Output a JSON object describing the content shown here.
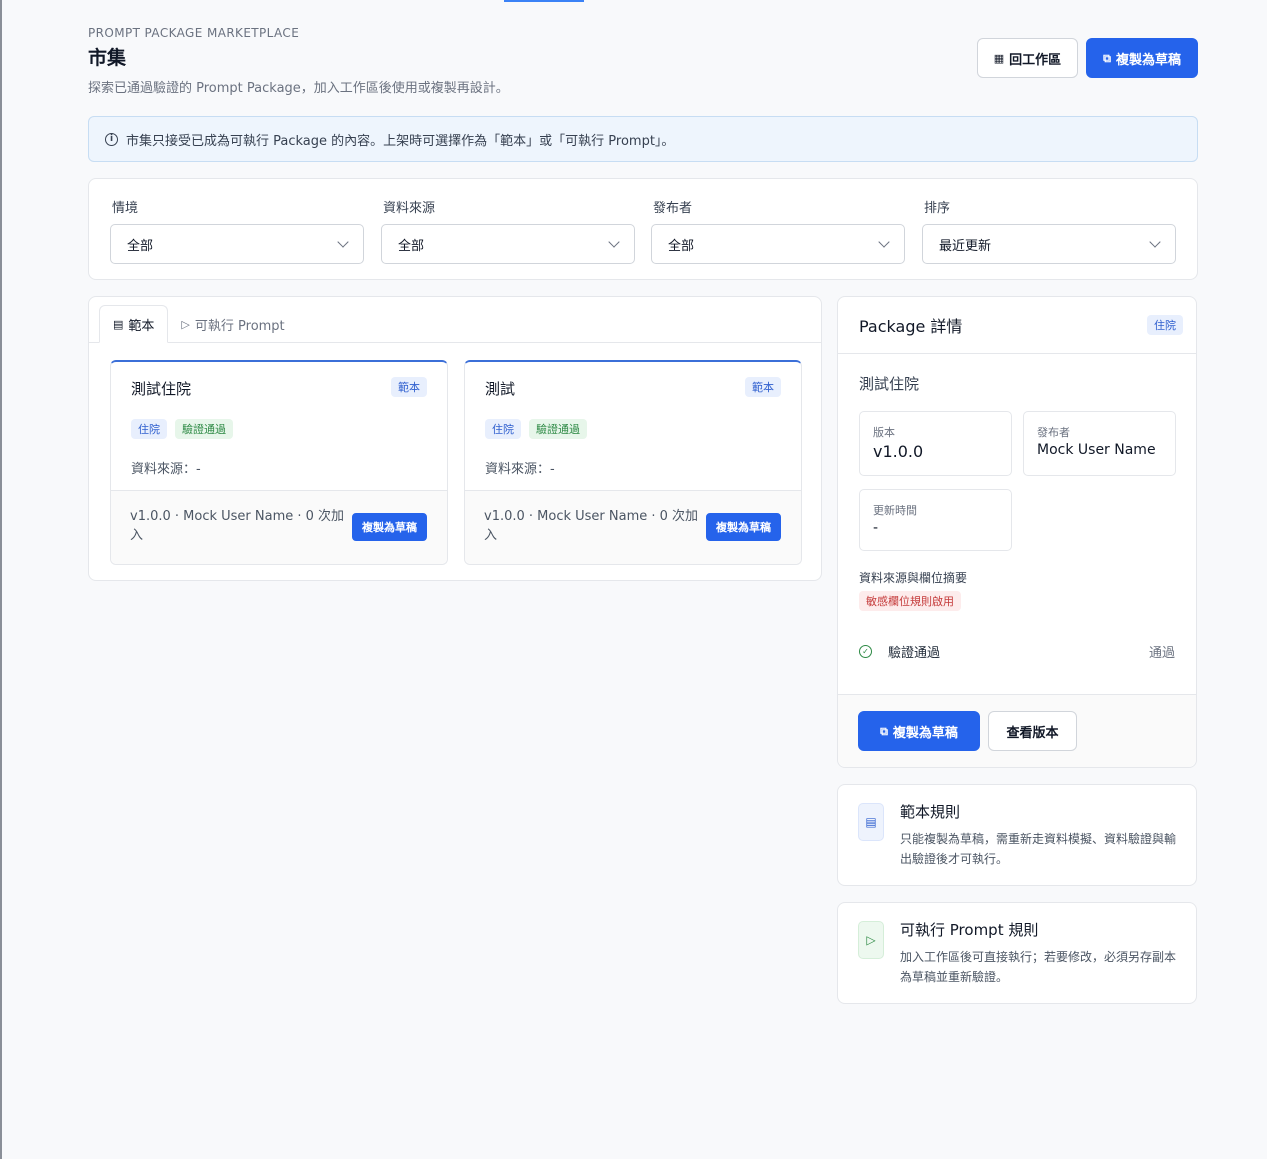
{
  "header": {
    "eyebrow": "PROMPT PACKAGE MARKETPLACE",
    "title": "市集",
    "subtitle": "探索已通過驗證的 Prompt Package，加入工作區後使用或複製再設計。",
    "back_label": "回工作區",
    "copy_label": "複製為草稿"
  },
  "banner": {
    "text": "市集只接受已成為可執行 Package 的內容。上架時可選擇作為「範本」或「可執行 Prompt」。"
  },
  "filters": [
    {
      "label": "情境",
      "value": "全部"
    },
    {
      "label": "資料來源",
      "value": "全部"
    },
    {
      "label": "發布者",
      "value": "全部"
    },
    {
      "label": "排序",
      "value": "最近更新"
    }
  ],
  "tabs": [
    {
      "label": "範本",
      "active": true
    },
    {
      "label": "可執行 Prompt",
      "active": false
    }
  ],
  "cards": [
    {
      "title": "測試住院",
      "type": "範本",
      "tags": [
        "住院",
        "驗證通過"
      ],
      "source": "資料來源：-",
      "meta": "v1.0.0 · Mock User Name · 0 次加入",
      "copy_label": "複製為草稿"
    },
    {
      "title": "測試",
      "type": "範本",
      "tags": [
        "住院",
        "驗證通過"
      ],
      "source": "資料來源：-",
      "meta": "v1.0.0 · Mock User Name · 0 次加入",
      "copy_label": "複製為草稿"
    }
  ],
  "detail": {
    "title": "Package 詳情",
    "badge": "住院",
    "name": "測試住院",
    "version_label": "版本",
    "version": "v1.0.0",
    "publisher_label": "發布者",
    "publisher": "Mock User Name",
    "updated_label": "更新時間",
    "updated": "-",
    "summary_label": "資料來源與欄位摘要",
    "sensitive_badge": "敏感欄位規則啟用",
    "check_label": "驗證通過",
    "check_status": "通過",
    "copy_label": "複製為草稿",
    "versions_label": "查看版本"
  },
  "rules": [
    {
      "title": "範本規則",
      "desc": "只能複製為草稿，需重新走資料模擬、資料驗證與輸出驗證後才可執行。",
      "icon": "template-icon"
    },
    {
      "title": "可執行 Prompt 規則",
      "desc": "加入工作區後可直接執行；若要修改，必須另存副本為草稿並重新驗證。",
      "icon": "play-icon"
    }
  ],
  "colors": {
    "primary": "#2563eb",
    "accent_border": "#3b6fd8",
    "success": "#2e8a45",
    "danger": "#c53b3b"
  }
}
